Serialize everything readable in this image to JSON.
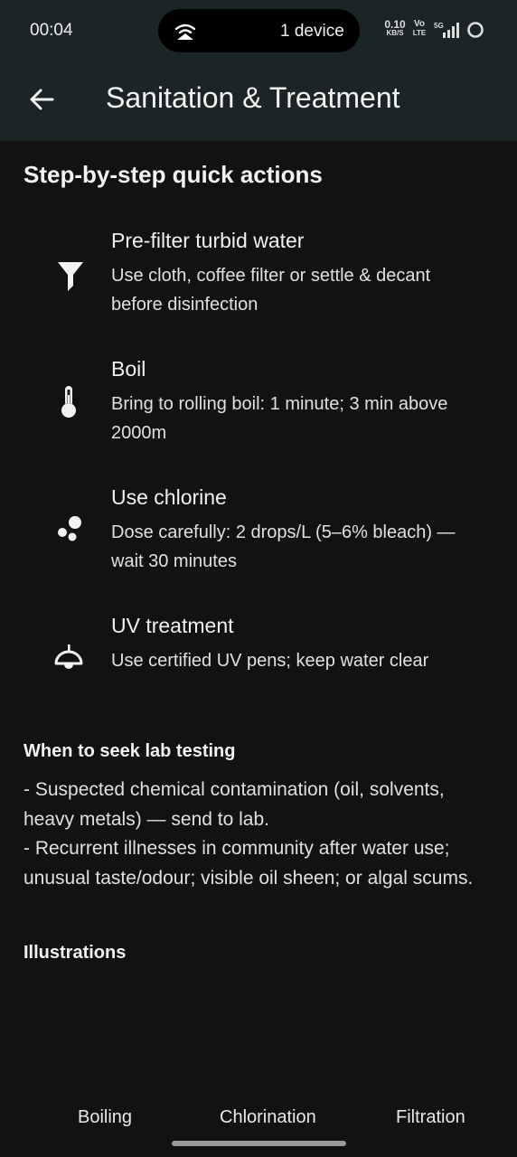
{
  "status_bar": {
    "time": "00:04",
    "hotspot": "1 device",
    "net_speed_value": "0.10",
    "net_speed_unit": "KB/S",
    "volte_top": "Vo",
    "volte_bottom": "LTE",
    "network": "5G"
  },
  "app_bar": {
    "title": "Sanitation & Treatment",
    "back_icon": "arrow-left-icon"
  },
  "quick_actions": {
    "heading": "Step-by-step quick actions",
    "items": [
      {
        "icon": "funnel-icon",
        "title": "Pre-filter turbid water",
        "desc": "Use cloth, coffee filter or settle & decant before disinfection"
      },
      {
        "icon": "thermometer-icon",
        "title": "Boil",
        "desc": "Bring to rolling boil: 1 minute; 3 min above 2000m"
      },
      {
        "icon": "bubbles-icon",
        "title": "Use chlorine",
        "desc": "Dose carefully: 2 drops/L (5–6% bleach) — wait 30 minutes"
      },
      {
        "icon": "uv-lamp-icon",
        "title": "UV treatment",
        "desc": "Use certified UV pens; keep water clear"
      }
    ]
  },
  "lab_testing": {
    "heading": "When to seek lab testing",
    "lines": [
      "- Suspected chemical contamination (oil, solvents, heavy metals) — send to lab.",
      "- Recurrent illnesses in community after water use; unusual taste/odour; visible oil sheen; or algal scums."
    ]
  },
  "illustrations": {
    "heading": "Illustrations",
    "tabs": [
      "Boiling",
      "Chlorination",
      "Filtration"
    ]
  },
  "colors": {
    "background": "#121212",
    "app_bar": "#1c2526",
    "text": "#f0f0f0"
  }
}
